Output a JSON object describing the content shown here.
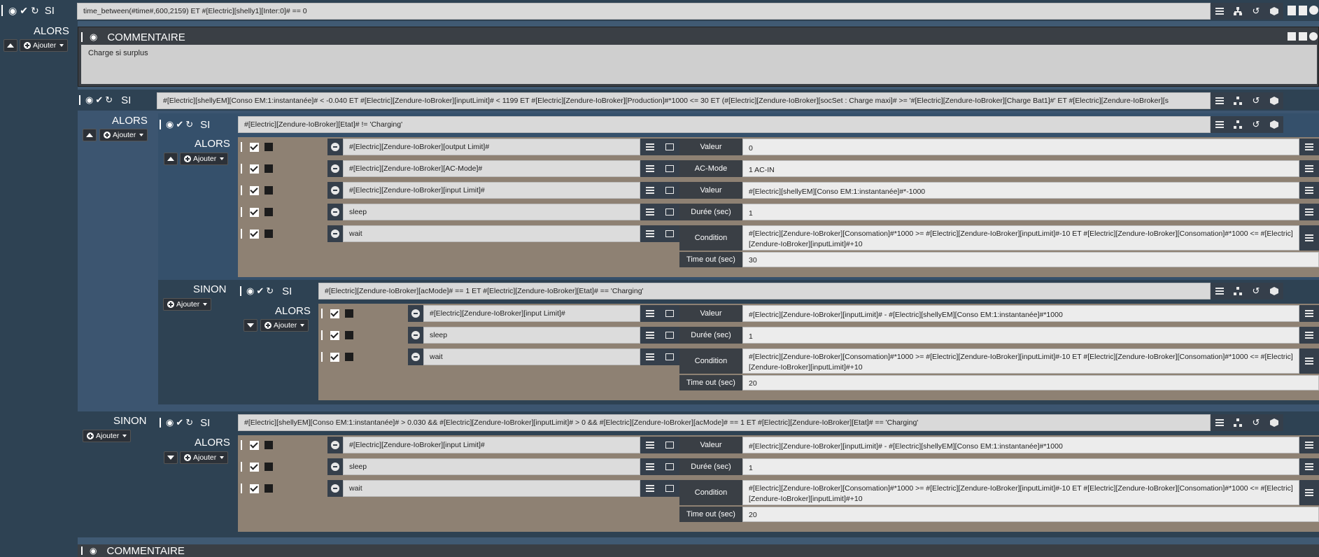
{
  "kw": {
    "si": "SI",
    "alors": "ALORS",
    "sinon": "SINON",
    "ajouter": "Ajouter",
    "commentaire": "COMMENTAIRE"
  },
  "top_condition": "time_between(#time#,600,2159) ET #[Electric][shelly1][Inter:0]# == 0",
  "comment_text": "Charge si surplus",
  "block1": {
    "condition": "#[Electric][shellyEM][Conso EM:1:instantanée]#  < -0.040 ET #[Electric][Zendure-IoBroker][inputLimit]# < 1199 ET #[Electric][Zendure-IoBroker][Production]#*1000 <= 30 ET (#[Electric][Zendure-IoBroker][socSet : Charge maxi]# >= '#[Electric][Zendure-IoBroker][Charge Bat1]#'  ET #[Electric][Zendure-IoBroker][s"
  },
  "inner_si": {
    "condition": "#[Electric][Zendure-IoBroker][Etat]# != 'Charging'"
  },
  "inner_actions": [
    {
      "cmd": "#[Electric][Zendure-IoBroker][output Limit]#",
      "label": "Valeur",
      "value": "0"
    },
    {
      "cmd": "#[Electric][Zendure-IoBroker][AC-Mode]#",
      "label": "AC-Mode",
      "value": "1 AC-IN"
    },
    {
      "cmd": "#[Electric][Zendure-IoBroker][input Limit]#",
      "label": "Valeur",
      "value": "#[Electric][shellyEM][Conso EM:1:instantanée]#*-1000"
    },
    {
      "cmd": "sleep",
      "label": "Durée (sec)",
      "value": "1"
    },
    {
      "cmd": "wait",
      "label": "Condition",
      "value": "#[Electric][Zendure-IoBroker][Consomation]#*1000 >= #[Electric][Zendure-IoBroker][inputLimit]#-10 ET #[Electric][Zendure-IoBroker][Consomation]#*1000 <= #[Electric][Zendure-IoBroker][inputLimit]#+10",
      "label2": "Time out (sec)",
      "value2": "30"
    }
  ],
  "inner_sinon_si": {
    "condition": "#[Electric][Zendure-IoBroker][acMode]# == 1 ET #[Electric][Zendure-IoBroker][Etat]# == 'Charging'"
  },
  "inner_sinon_actions": [
    {
      "cmd": "#[Electric][Zendure-IoBroker][input Limit]#",
      "label": "Valeur",
      "value": "#[Electric][Zendure-IoBroker][inputLimit]# - #[Electric][shellyEM][Conso EM:1:instantanée]#*1000"
    },
    {
      "cmd": "sleep",
      "label": "Durée (sec)",
      "value": "1"
    },
    {
      "cmd": "wait",
      "label": "Condition",
      "value": "#[Electric][Zendure-IoBroker][Consomation]#*1000 >= #[Electric][Zendure-IoBroker][inputLimit]#-10 ET #[Electric][Zendure-IoBroker][Consomation]#*1000 <= #[Electric][Zendure-IoBroker][inputLimit]#+10",
      "label2": "Time out (sec)",
      "value2": "20"
    }
  ],
  "outer_sinon_si": {
    "condition": "#[Electric][shellyEM][Conso EM:1:instantanée]# > 0.030 && #[Electric][Zendure-IoBroker][inputLimit]# > 0 &&  #[Electric][Zendure-IoBroker][acMode]# == 1 ET #[Electric][Zendure-IoBroker][Etat]# == 'Charging'"
  },
  "outer_sinon_actions": [
    {
      "cmd": "#[Electric][Zendure-IoBroker][input Limit]#",
      "label": "Valeur",
      "value": "#[Electric][Zendure-IoBroker][inputLimit]# - #[Electric][shellyEM][Conso EM:1:instantanée]#*1000"
    },
    {
      "cmd": "sleep",
      "label": "Durée (sec)",
      "value": "1"
    },
    {
      "cmd": "wait",
      "label": "Condition",
      "value": "#[Electric][Zendure-IoBroker][Consomation]#*1000 >= #[Electric][Zendure-IoBroker][inputLimit]#-10 ET #[Electric][Zendure-IoBroker][Consomation]#*1000 <= #[Electric][Zendure-IoBroker][inputLimit]#+10",
      "label2": "Time out (sec)",
      "value2": "20"
    }
  ],
  "icons": [
    "move-icon",
    "eye-icon",
    "check-icon",
    "refresh-icon",
    "list-icon",
    "sitemap-icon",
    "history-icon",
    "cube-icon",
    "copy-icon",
    "minus-circle-icon",
    "plus-circle-icon",
    "caret-down-icon",
    "chevron-up-icon"
  ]
}
